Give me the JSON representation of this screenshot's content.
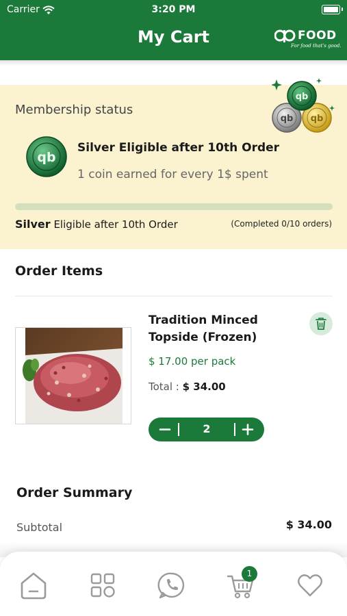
{
  "status_bar": {
    "carrier": "Carrier",
    "time": "3:20 PM"
  },
  "header": {
    "title": "My Cart",
    "brand": {
      "word": "FOOD",
      "tagline": "For food that's good."
    }
  },
  "membership": {
    "label": "Membership status",
    "tier_title": "Silver Eligible after 10th Order",
    "earn_rate": "1  coin earned for every 1$ spent",
    "progress_tier": "Silver",
    "progress_text": "Eligible after 10th Order",
    "progress_count": "(Completed 0/10 orders)",
    "progress_fraction": 0.0
  },
  "order_items": {
    "title": "Order Items",
    "items": [
      {
        "name": "Tradition Minced Topside (Frozen)",
        "price": "$ 17.00 per pack",
        "total_label": "Total : ",
        "total_value": "$ 34.00",
        "quantity": "2"
      }
    ]
  },
  "summary": {
    "title": "Order Summary",
    "subtotal_label": "Subtotal",
    "subtotal_value": "$ 34.00"
  },
  "tabbar": {
    "cart_badge": "1",
    "active_color": "#1b7a3a",
    "icon_color": "#9a9a9a"
  },
  "colors": {
    "brand_green": "#1b7a3a",
    "membership_bg": "#fbf2d0"
  }
}
